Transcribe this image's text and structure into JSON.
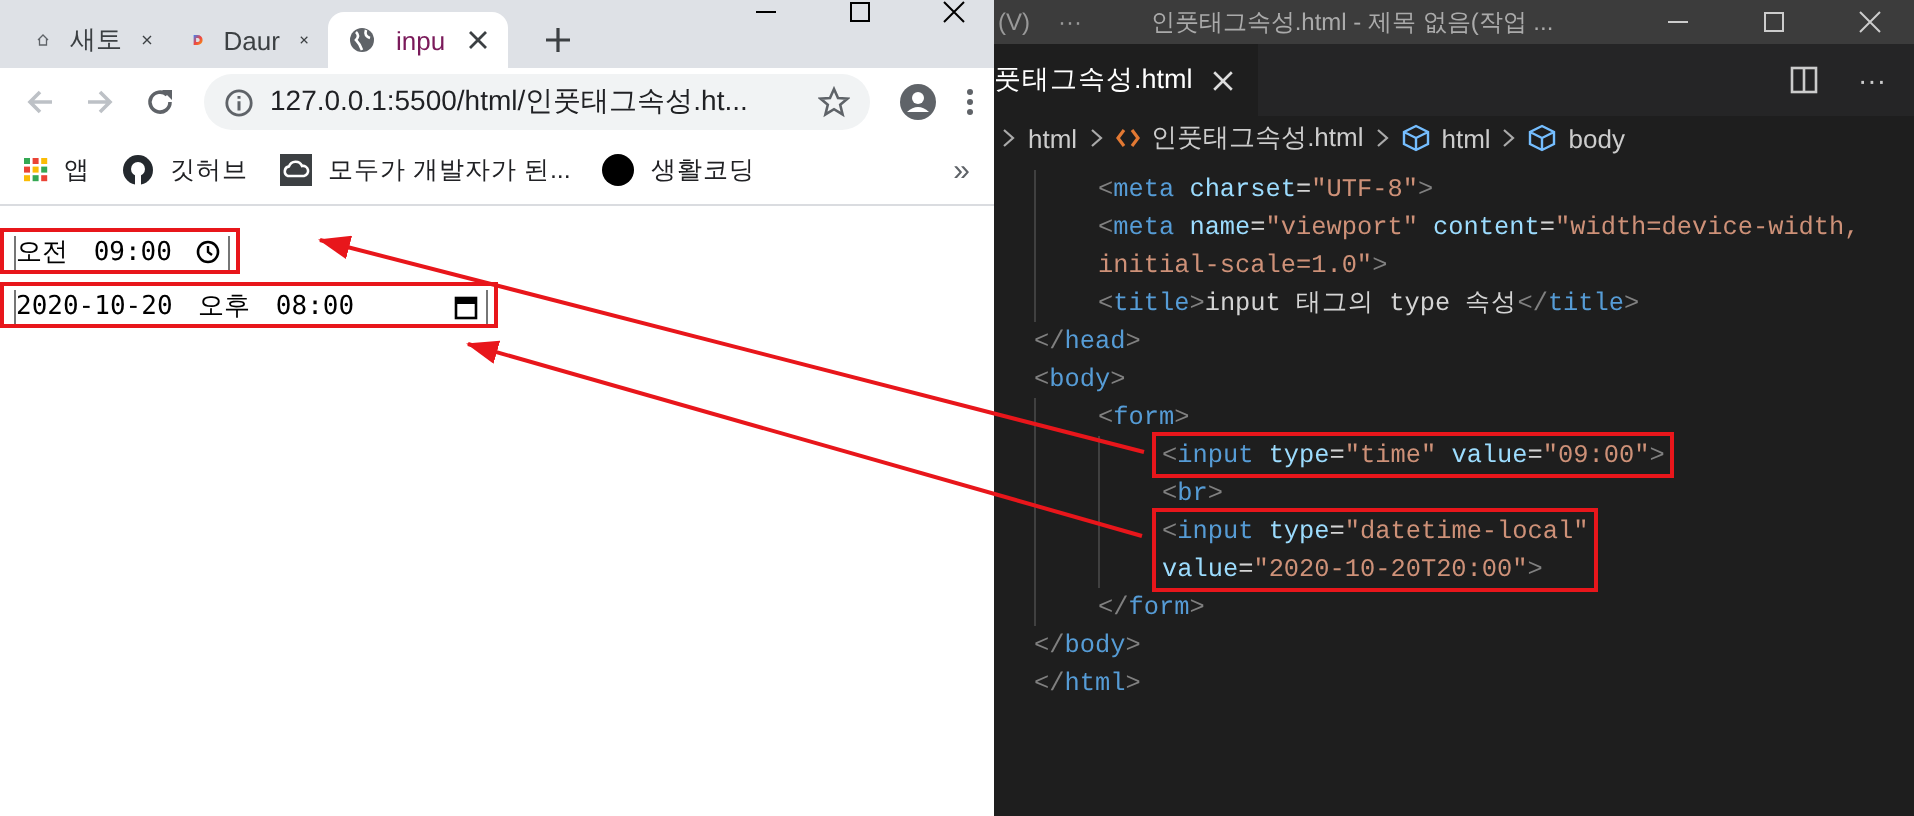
{
  "browser": {
    "tabs": [
      {
        "kind": "home",
        "title": "새토",
        "selected": false
      },
      {
        "kind": "site",
        "title": "Daur",
        "selected": false
      },
      {
        "kind": "page",
        "title": "inpu",
        "selected": true
      }
    ],
    "address": "127.0.0.1:5500/html/인풋태그속성.ht...",
    "bookmarks": [
      {
        "kind": "apps",
        "label": "앱"
      },
      {
        "kind": "repo",
        "label": "깃허브"
      },
      {
        "kind": "cloud",
        "label": "모두가 개발자가 된..."
      },
      {
        "kind": "circle",
        "label": "생활코딩"
      }
    ],
    "more_bookmarks": "»",
    "page": {
      "time_input": {
        "value": "오전 09:00",
        "highlighted": true
      },
      "datetime_input": {
        "value": "2020-10-20 오후 08:00",
        "highlighted": true
      }
    }
  },
  "editor": {
    "menu": "(V)",
    "menu_more": "···",
    "title": "인풋태그속성.html - 제목 없음(작업 ...",
    "tab": {
      "title": "풋태그속성.html",
      "selected": true
    },
    "tab_more": "···",
    "breadcrumbs": [
      {
        "kind": "folder",
        "label": "html"
      },
      {
        "kind": "file",
        "label": "인풋태그속성.html"
      },
      {
        "kind": "element",
        "label": "html"
      },
      {
        "kind": "element",
        "label": "body"
      }
    ],
    "lines": [
      {
        "children": [
          {
            "tokens": [
              {
                "kind": "punct",
                "t": "<"
              },
              {
                "kind": "tag",
                "t": "meta"
              },
              {
                "kind": "attr",
                "t": " charset"
              },
              {
                "kind": "text",
                "t": "="
              },
              {
                "kind": "string",
                "t": "\"UTF-8\""
              },
              {
                "kind": "punct",
                "t": ">"
              }
            ]
          },
          {
            "tokens": [
              {
                "kind": "punct",
                "t": "<"
              },
              {
                "kind": "tag",
                "t": "meta"
              },
              {
                "kind": "attr",
                "t": " name"
              },
              {
                "kind": "text",
                "t": "="
              },
              {
                "kind": "string",
                "t": "\"viewport\""
              },
              {
                "kind": "attr",
                "t": " content"
              },
              {
                "kind": "text",
                "t": "="
              },
              {
                "kind": "string",
                "t": "\"width=device-width,"
              }
            ],
            "wrap": [
              {
                "kind": "string",
                "t": "initial-scale=1.0\""
              },
              {
                "kind": "punct",
                "t": ">"
              }
            ]
          },
          {
            "tokens": [
              {
                "kind": "punct",
                "t": "<"
              },
              {
                "kind": "tag",
                "t": "title"
              },
              {
                "kind": "punct",
                "t": ">"
              },
              {
                "kind": "text",
                "t": "input 태그의 type 속성"
              },
              {
                "kind": "punct",
                "t": "</"
              },
              {
                "kind": "tag",
                "t": "title"
              },
              {
                "kind": "punct",
                "t": ">"
              }
            ]
          }
        ]
      },
      {
        "tokens": [
          {
            "kind": "punct",
            "t": "</"
          },
          {
            "kind": "tag",
            "t": "head"
          },
          {
            "kind": "punct",
            "t": ">"
          }
        ]
      },
      {
        "tokens": [
          {
            "kind": "punct",
            "t": "<"
          },
          {
            "kind": "tag",
            "t": "body"
          },
          {
            "kind": "punct",
            "t": ">"
          }
        ],
        "children": [
          {
            "tokens": [
              {
                "kind": "punct",
                "t": "<"
              },
              {
                "kind": "tag",
                "t": "form"
              },
              {
                "kind": "punct",
                "t": ">"
              }
            ],
            "children": [
              {
                "tokens": [
                  {
                    "kind": "punct",
                    "t": "<"
                  },
                  {
                    "kind": "tag",
                    "t": "input"
                  },
                  {
                    "kind": "attr",
                    "t": " type"
                  },
                  {
                    "kind": "text",
                    "t": "="
                  },
                  {
                    "kind": "string",
                    "t": "\"time\""
                  },
                  {
                    "kind": "attr",
                    "t": " value"
                  },
                  {
                    "kind": "text",
                    "t": "="
                  },
                  {
                    "kind": "string",
                    "t": "\"09:00\""
                  },
                  {
                    "kind": "punct",
                    "t": ">"
                  }
                ],
                "highlighted": true
              },
              {
                "tokens": [
                  {
                    "kind": "punct",
                    "t": "<"
                  },
                  {
                    "kind": "tag",
                    "t": "br"
                  },
                  {
                    "kind": "punct",
                    "t": ">"
                  }
                ],
                "highlighted": false
              },
              {
                "tokens": [
                  {
                    "kind": "punct",
                    "t": "<"
                  },
                  {
                    "kind": "tag",
                    "t": "input"
                  },
                  {
                    "kind": "attr",
                    "t": " type"
                  },
                  {
                    "kind": "text",
                    "t": "="
                  },
                  {
                    "kind": "string",
                    "t": "\"datetime-local\""
                  }
                ],
                "wrap": [
                  {
                    "kind": "attr",
                    "t": "value"
                  },
                  {
                    "kind": "text",
                    "t": "="
                  },
                  {
                    "kind": "string",
                    "t": "\"2020-10-20T20:00\""
                  },
                  {
                    "kind": "punct",
                    "t": ">"
                  }
                ],
                "highlighted": true
              }
            ]
          },
          {
            "tokens": [
              {
                "kind": "punct",
                "t": "</"
              },
              {
                "kind": "tag",
                "t": "form"
              },
              {
                "kind": "punct",
                "t": ">"
              }
            ]
          }
        ]
      },
      {
        "tokens": [
          {
            "kind": "punct",
            "t": "</"
          },
          {
            "kind": "tag",
            "t": "body"
          },
          {
            "kind": "punct",
            "t": ">"
          }
        ]
      },
      {
        "tokens": [
          {
            "kind": "punct",
            "t": "</"
          },
          {
            "kind": "tag",
            "t": "html"
          },
          {
            "kind": "punct",
            "t": ">"
          }
        ]
      }
    ]
  }
}
